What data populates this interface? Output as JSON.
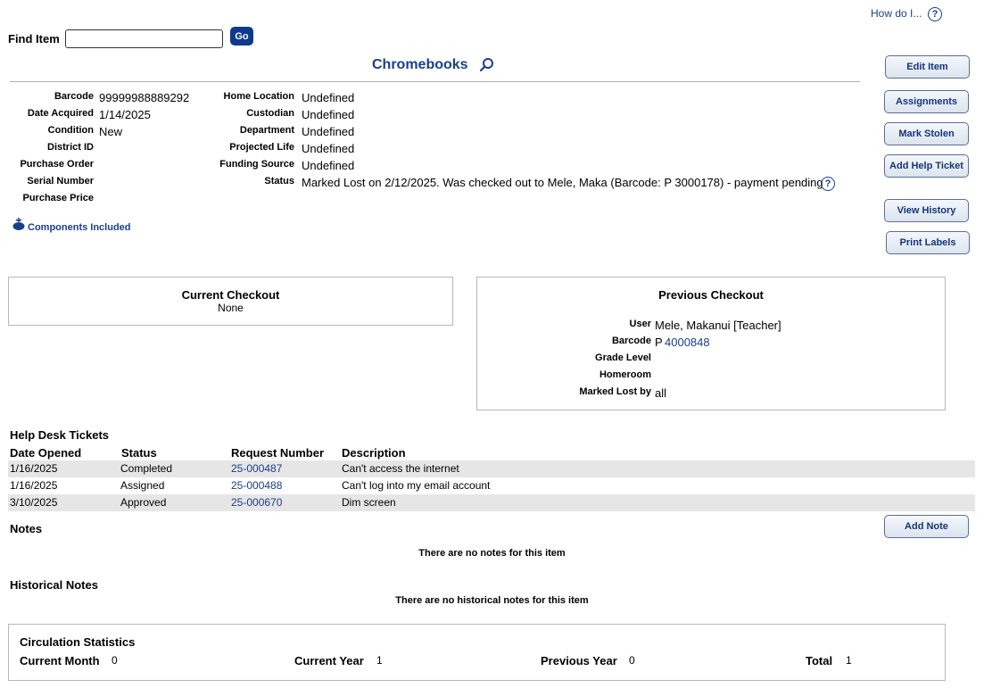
{
  "top": {
    "how_do_i": "How do I...",
    "help_symbol": "?"
  },
  "find": {
    "label": "Find Item",
    "value": "",
    "go_label": "Go"
  },
  "item": {
    "title": "Chromebooks"
  },
  "fields_left": [
    {
      "label": "Barcode",
      "value": "99999988889292"
    },
    {
      "label": "Date Acquired",
      "value": "1/14/2025"
    },
    {
      "label": "Condition",
      "value": "New"
    },
    {
      "label": "District ID",
      "value": ""
    },
    {
      "label": "Purchase Order",
      "value": ""
    },
    {
      "label": "Serial Number",
      "value": ""
    },
    {
      "label": "Purchase Price",
      "value": ""
    }
  ],
  "fields_right": [
    {
      "label": "Home Location",
      "value": "Undefined"
    },
    {
      "label": "Custodian",
      "value": "Undefined"
    },
    {
      "label": "Department",
      "value": "Undefined"
    },
    {
      "label": "Projected Life",
      "value": "Undefined"
    },
    {
      "label": "Funding Source",
      "value": "Undefined"
    },
    {
      "label": "Status",
      "value": "Marked Lost on 2/12/2025. Was checked out to Mele, Maka (Barcode: P 3000178) - payment pending"
    }
  ],
  "components": {
    "label": "Components Included"
  },
  "actions": {
    "edit_item": "Edit Item",
    "assignments": "Assignments",
    "mark_stolen": "Mark Stolen",
    "add_help_ticket": "Add Help Ticket",
    "view_history": "View History",
    "print_labels": "Print Labels"
  },
  "current_checkout": {
    "title": "Current Checkout",
    "value": "None"
  },
  "previous_checkout": {
    "title": "Previous Checkout",
    "user_label": "User",
    "user_value": "Mele, Makanui [Teacher]",
    "barcode_label": "Barcode",
    "barcode_prefix": "P",
    "barcode_link": "4000848",
    "grade_label": "Grade Level",
    "grade_value": "",
    "homeroom_label": "Homeroom",
    "homeroom_value": "",
    "lost_by_label": "Marked Lost by",
    "lost_by_value": "all"
  },
  "tickets": {
    "title": "Help Desk Tickets",
    "headers": [
      "Date Opened",
      "Status",
      "Request Number",
      "Description"
    ],
    "rows": [
      {
        "date": "1/16/2025",
        "status": "Completed",
        "request": "25-000487",
        "description": "Can't access the internet"
      },
      {
        "date": "1/16/2025",
        "status": "Assigned",
        "request": "25-000488",
        "description": "Can't log into my email account"
      },
      {
        "date": "3/10/2025",
        "status": "Approved",
        "request": "25-000670",
        "description": "Dim screen"
      }
    ]
  },
  "notes": {
    "title": "Notes",
    "add_label": "Add Note",
    "empty": "There are no notes for this item"
  },
  "historical_notes": {
    "title": "Historical Notes",
    "empty": "There are no historical notes for this item"
  },
  "circulation": {
    "title": "Circulation Statistics",
    "current_month_label": "Current Month",
    "current_month_value": "0",
    "current_year_label": "Current Year",
    "current_year_value": "1",
    "previous_year_label": "Previous Year",
    "previous_year_value": "0",
    "total_label": "Total",
    "total_value": "1"
  },
  "colors": {
    "accent": "#1a3f8a",
    "button_dark": "#0d3a8c",
    "row_shade": "#e6e6e6"
  }
}
